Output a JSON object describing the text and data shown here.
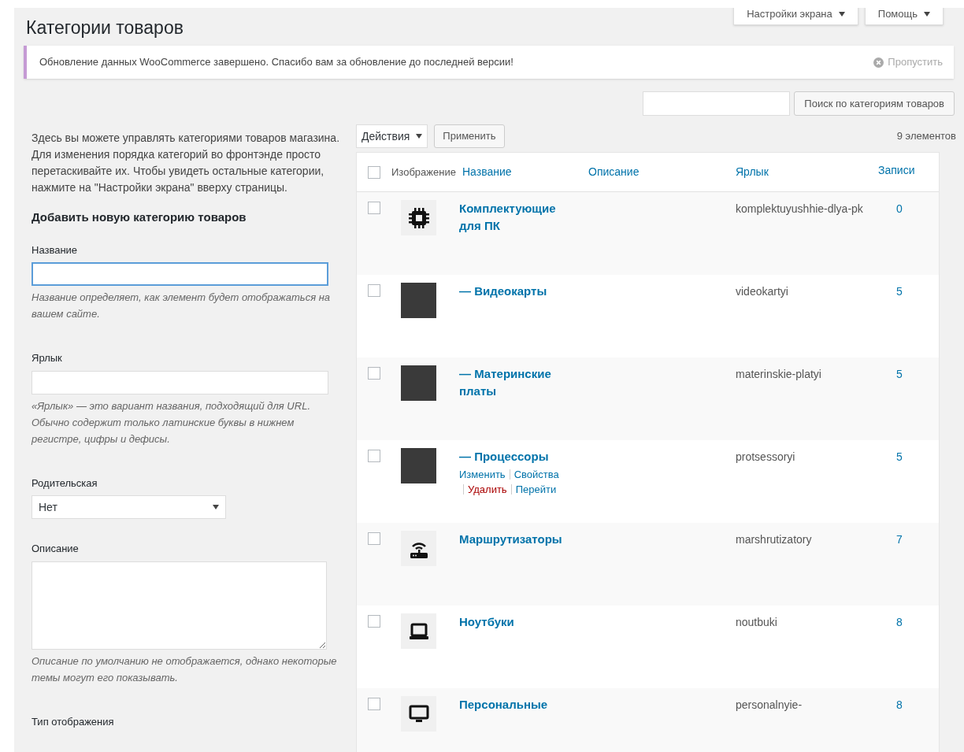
{
  "top_buttons": [
    {
      "label": "Настройки экрана"
    },
    {
      "label": "Помощь"
    }
  ],
  "page_title": "Категории товаров",
  "notice": {
    "text": "Обновление данных WooCommerce завершено. Спасибо вам за обновление до последней версии!",
    "dismiss": "Пропустить"
  },
  "search": {
    "button": "Поиск по категориям товаров"
  },
  "intro": "Здесь вы можете управлять категориями товаров магазина. Для изменения порядка категорий во фронтэнде просто перетаскивайте их. Чтобы увидеть остальные категории, нажмите на \"Настройки экрана\" вверху страницы.",
  "form": {
    "title": "Добавить новую категорию товаров",
    "fields": [
      {
        "kind": "text",
        "label": "Название",
        "focused": true,
        "hint": "Название определяет, как элемент будет отображаться на вашем сайте."
      },
      {
        "kind": "text",
        "label": "Ярлык",
        "focused": false,
        "hint": "«Ярлык» — это вариант названия, подходящий для URL. Обычно содержит только латинские буквы в нижнем регистре, цифры и дефисы."
      },
      {
        "kind": "select",
        "label": "Родительская",
        "value": "Нет"
      },
      {
        "kind": "textarea",
        "label": "Описание",
        "hint": "Описание по умолчанию не отображается, однако некоторые темы могут его показывать."
      },
      {
        "kind": "label",
        "label": "Тип отображения"
      }
    ]
  },
  "bulk": {
    "select": "Действия",
    "apply": "Применить",
    "count": "9 элементов"
  },
  "table": {
    "header_checked": false,
    "columns": [
      "Изображение",
      "Название",
      "Описание",
      "Ярлык",
      "Записи"
    ],
    "rows": [
      {
        "checked": false,
        "kind": "chip",
        "name": "Комплектующие для ПК",
        "slug": "komplektuyushhie-dlya-pk",
        "count": "0"
      },
      {
        "checked": false,
        "kind": "photo",
        "name": "— Видеокарты",
        "slug": "videokartyi",
        "count": "5"
      },
      {
        "checked": false,
        "kind": "photo",
        "name": "— Материнские платы",
        "slug": "materinskie-platyi",
        "count": "5"
      },
      {
        "checked": false,
        "kind": "photo",
        "name": "— Процессоры",
        "slug": "protsessoryi",
        "count": "5",
        "actions": [
          {
            "label": "Изменить",
            "kind": "link"
          },
          {
            "label": "Свойства",
            "kind": "link"
          },
          {
            "label": "Удалить",
            "kind": "delete"
          },
          {
            "label": "Перейти",
            "kind": "link"
          }
        ]
      },
      {
        "checked": false,
        "kind": "router",
        "name": "Маршрутизаторы",
        "slug": "marshrutizatory",
        "count": "7"
      },
      {
        "checked": false,
        "kind": "laptop",
        "name": "Ноутбуки",
        "slug": "noutbuki",
        "count": "8"
      },
      {
        "checked": false,
        "kind": "monitor",
        "name": "Персональные",
        "slug": "personalnyie-",
        "count": "8"
      }
    ]
  }
}
